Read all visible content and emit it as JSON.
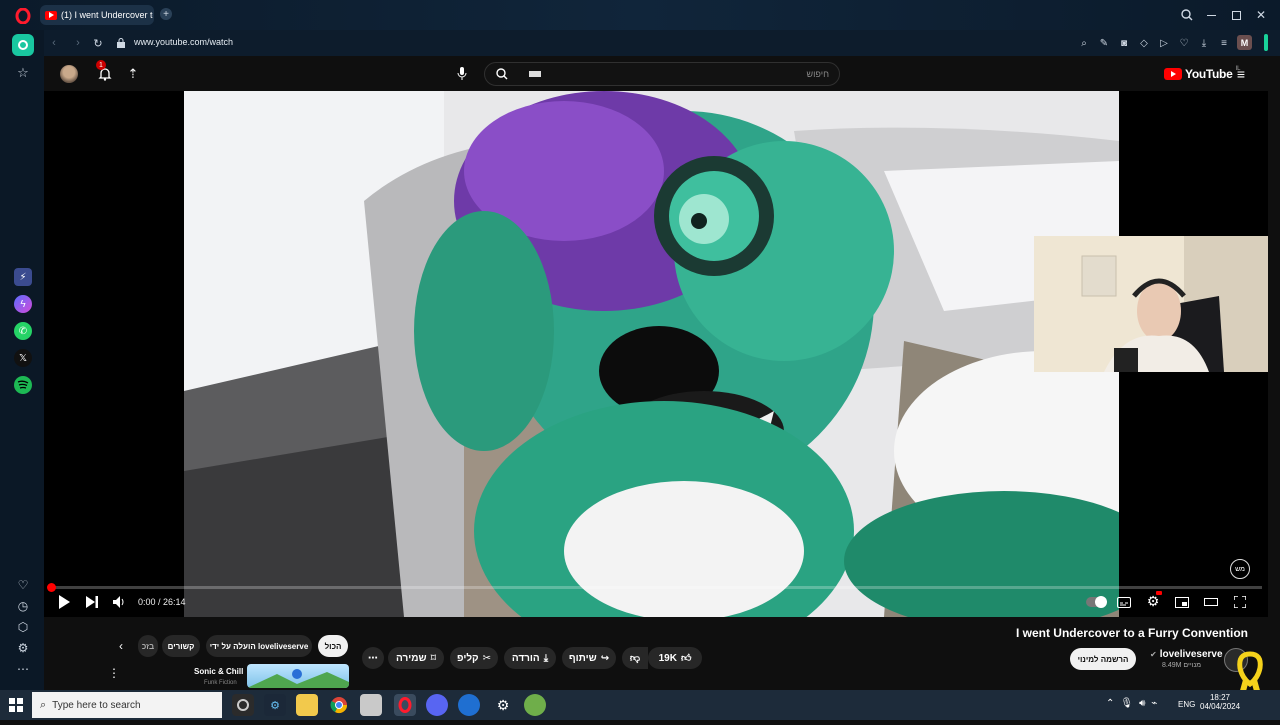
{
  "browser": {
    "tab_title": "(1) I went Undercover to a",
    "url": "www.youtube.com/watch",
    "profile_initial": "M"
  },
  "youtube": {
    "notification_count": "1",
    "search_placeholder": "חיפוש",
    "logo": "YouTube",
    "logo_region": "IL"
  },
  "player": {
    "time": "0:00 / 26:14",
    "progress": 0.0,
    "cc": "מש",
    "colors": {
      "progress": "#ff0000"
    }
  },
  "video": {
    "title": "I went Undercover to a Furry Convention",
    "channel": "loveliveserve",
    "subscribers": "8.49M מנויים",
    "subscribe_label": "הרשמה למינוי",
    "likes": "19K",
    "share": "שיתוף",
    "download": "הורדה",
    "clip": "קליפ",
    "save": "שמירה",
    "more": "⋯"
  },
  "chips": {
    "all": "הכול",
    "uploaded_by": "הועלה על ידי loveliveserve",
    "related": "קשורים",
    "partial": "בזכ"
  },
  "recommended": {
    "title": "Sonic & Chill",
    "channel": "Funk Fiction"
  },
  "taskbar": {
    "search_placeholder": "Type here to search",
    "lang": "ENG",
    "time": "18:27",
    "date": "04/04/2024"
  }
}
